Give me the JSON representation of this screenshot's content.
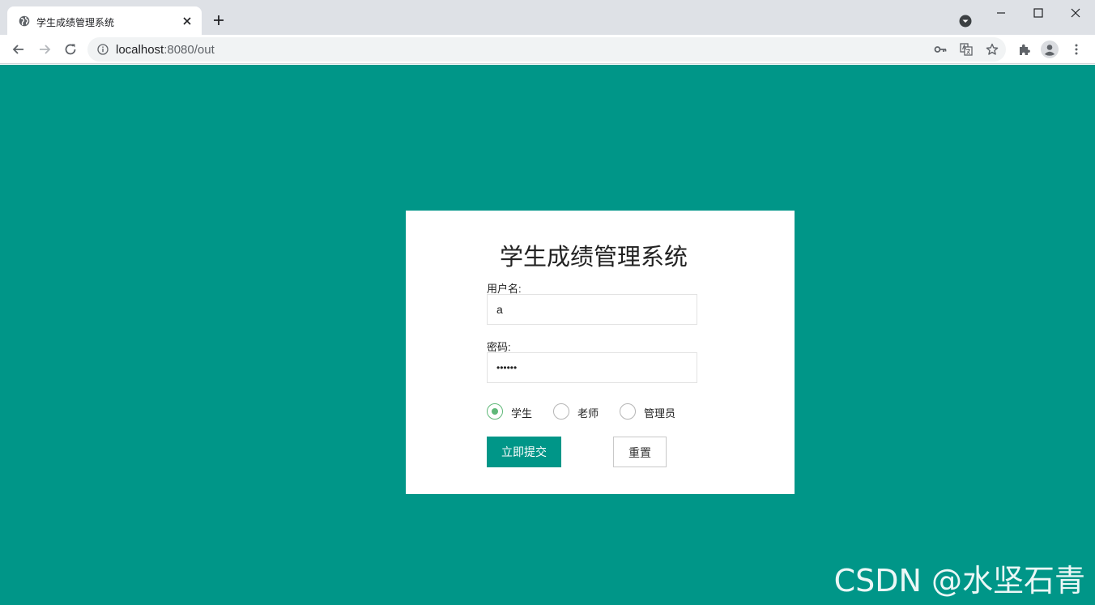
{
  "browser": {
    "tab_title": "学生成绩管理系统",
    "url_host": "localhost",
    "url_rest": ":8080/out"
  },
  "login": {
    "title": "学生成绩管理系统",
    "username_label": "用户名:",
    "username_value": "a",
    "password_label": "密码:",
    "password_masked": "••••••",
    "roles": [
      {
        "label": "学生",
        "checked": true
      },
      {
        "label": "老师",
        "checked": false
      },
      {
        "label": "管理员",
        "checked": false
      }
    ],
    "submit_label": "立即提交",
    "reset_label": "重置"
  },
  "watermark": "CSDN @水坚石青",
  "colors": {
    "page_background": "#009688",
    "primary_button": "#009688",
    "radio_checked": "#5fb878"
  },
  "icons": [
    "globe-icon",
    "close-icon",
    "plus-icon",
    "tab-search-icon",
    "minimize-icon",
    "maximize-icon",
    "back-icon",
    "forward-icon",
    "reload-icon",
    "info-icon",
    "key-icon",
    "translate-icon",
    "star-icon",
    "extensions-icon",
    "profile-icon",
    "menu-icon"
  ]
}
